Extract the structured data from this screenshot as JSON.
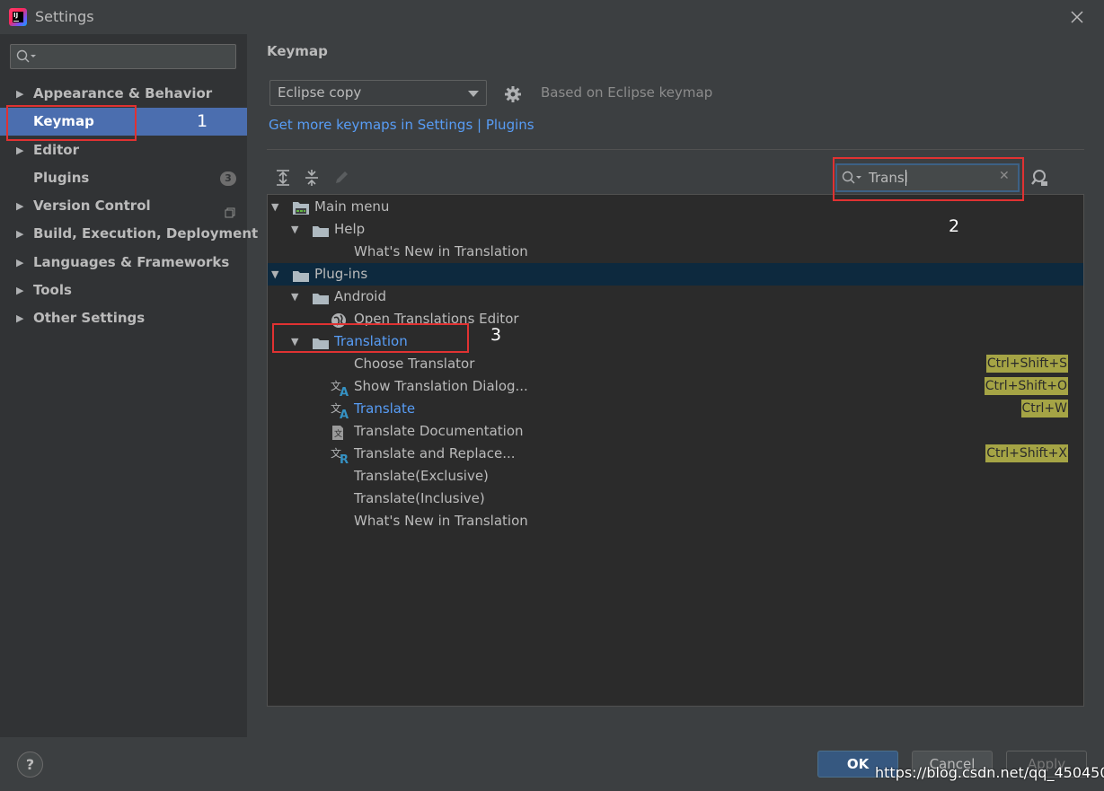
{
  "window": {
    "title": "Settings"
  },
  "sidebar": {
    "search_placeholder": "",
    "items": [
      {
        "label": "Appearance & Behavior",
        "expandable": true
      },
      {
        "label": "Keymap",
        "expandable": false,
        "selected": true
      },
      {
        "label": "Editor",
        "expandable": true
      },
      {
        "label": "Plugins",
        "expandable": false,
        "badge": "3"
      },
      {
        "label": "Version Control",
        "expandable": true
      },
      {
        "label": "Build, Execution, Deployment",
        "expandable": true
      },
      {
        "label": "Languages & Frameworks",
        "expandable": true
      },
      {
        "label": "Tools",
        "expandable": true
      },
      {
        "label": "Other Settings",
        "expandable": true
      }
    ]
  },
  "keymap": {
    "title": "Keymap",
    "selected_keymap": "Eclipse copy",
    "based_on": "Based on Eclipse keymap",
    "more_link": "Get more keymaps in Settings | Plugins",
    "search_value": "Transl"
  },
  "tree": [
    {
      "label": "Main menu",
      "level": 0,
      "expanded": true,
      "icon": "main-menu-icon"
    },
    {
      "label": "Help",
      "level": 1,
      "expanded": true,
      "icon": "folder-icon"
    },
    {
      "label": "What's New in Translation",
      "level": 2,
      "icon": ""
    },
    {
      "label": "Plug-ins",
      "level": 0,
      "expanded": true,
      "icon": "folder-icon",
      "selected": true
    },
    {
      "label": "Android",
      "level": 1,
      "expanded": true,
      "icon": "folder-icon"
    },
    {
      "label": "Open Translations Editor",
      "level": 2,
      "icon": "globe-icon"
    },
    {
      "label": "Translation",
      "level": 1,
      "expanded": true,
      "icon": "folder-icon",
      "highlight": true
    },
    {
      "label": "Choose Translator",
      "level": 2,
      "icon": "",
      "shortcut": "Ctrl+Shift+S"
    },
    {
      "label": "Show Translation Dialog...",
      "level": 2,
      "icon": "translate-icon",
      "shortcut": "Ctrl+Shift+O"
    },
    {
      "label": "Translate",
      "level": 2,
      "icon": "translate-icon",
      "shortcut": "Ctrl+W",
      "highlight": true
    },
    {
      "label": "Translate Documentation",
      "level": 2,
      "icon": "document-translate-icon"
    },
    {
      "label": "Translate and Replace...",
      "level": 2,
      "icon": "translate-replace-icon",
      "shortcut": "Ctrl+Shift+X"
    },
    {
      "label": "Translate(Exclusive)",
      "level": 2,
      "icon": ""
    },
    {
      "label": "Translate(Inclusive)",
      "level": 2,
      "icon": ""
    },
    {
      "label": "What's New in Translation",
      "level": 2,
      "icon": ""
    }
  ],
  "annotations": [
    "1",
    "2",
    "3"
  ],
  "buttons": {
    "help": "?",
    "ok": "OK",
    "cancel": "Cancel",
    "apply": "Apply"
  },
  "watermark": "https://blog.csdn.net/qq_45045083",
  "colors": {
    "accent": "#4b6eaf",
    "link": "#589df6",
    "shortcut_bg": "#a5a445",
    "annotation": "#e03232"
  }
}
